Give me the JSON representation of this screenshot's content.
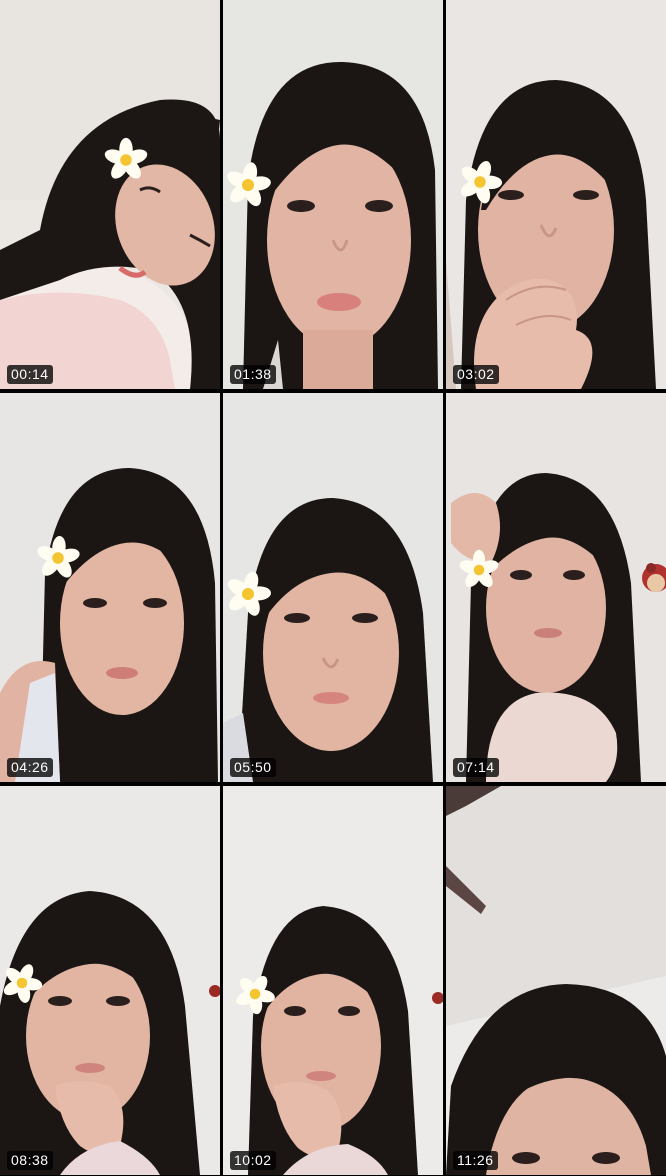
{
  "thumbnails": [
    {
      "timestamp": "00:14",
      "flower_icon": "plumeria-flower-icon",
      "scene": "lying-on-pillow"
    },
    {
      "timestamp": "01:38",
      "flower_icon": "plumeria-flower-icon",
      "scene": "face-closeup"
    },
    {
      "timestamp": "03:02",
      "flower_icon": "plumeria-flower-icon",
      "scene": "hand-at-mouth"
    },
    {
      "timestamp": "04:26",
      "flower_icon": "plumeria-flower-icon",
      "scene": "talking"
    },
    {
      "timestamp": "05:50",
      "flower_icon": "plumeria-flower-icon",
      "scene": "face-closeup"
    },
    {
      "timestamp": "07:14",
      "flower_icon": "plumeria-flower-icon",
      "scene": "hand-in-hair"
    },
    {
      "timestamp": "08:38",
      "flower_icon": "plumeria-flower-icon",
      "scene": "chin-on-hand"
    },
    {
      "timestamp": "10:02",
      "flower_icon": "plumeria-flower-icon",
      "scene": "chin-on-hand"
    },
    {
      "timestamp": "11:26",
      "flower_icon": "",
      "scene": "top-of-head"
    }
  ],
  "colors": {
    "background": "#000000",
    "wall": "#e9e6e3",
    "hair": "#1b1614",
    "skin": "#e2b5a3",
    "flower_petal": "#fffdf2",
    "flower_center": "#f4c431",
    "timestamp_bg": "#000000",
    "timestamp_text": "#ffffff"
  }
}
